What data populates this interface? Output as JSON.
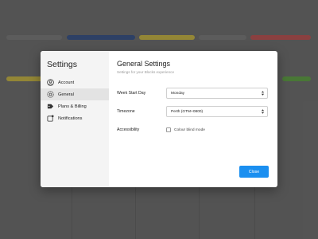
{
  "sidebar": {
    "title": "Settings",
    "items": [
      {
        "label": "Account",
        "icon": "user-circle-icon"
      },
      {
        "label": "General",
        "icon": "gear-icon",
        "active": true
      },
      {
        "label": "Plans & Billing",
        "icon": "tag-icon"
      },
      {
        "label": "Notifications",
        "icon": "notification-icon"
      }
    ]
  },
  "main": {
    "title": "General Settings",
    "subtitle": "Settings for your Blocks experience",
    "week_start": {
      "label": "Week Start Day",
      "value": "Monday"
    },
    "timezone": {
      "label": "Timezone",
      "value": "Perth (GTM+0800)"
    },
    "accessibility": {
      "label": "Accessibility",
      "option": "Colour blind mode",
      "checked": false
    },
    "close_label": "Close"
  },
  "colors": {
    "accent": "#1b8ff0",
    "bg_bars": [
      "#2a4a8a",
      "#d8c23a",
      "#c94a4a",
      "#5aa83a"
    ]
  }
}
